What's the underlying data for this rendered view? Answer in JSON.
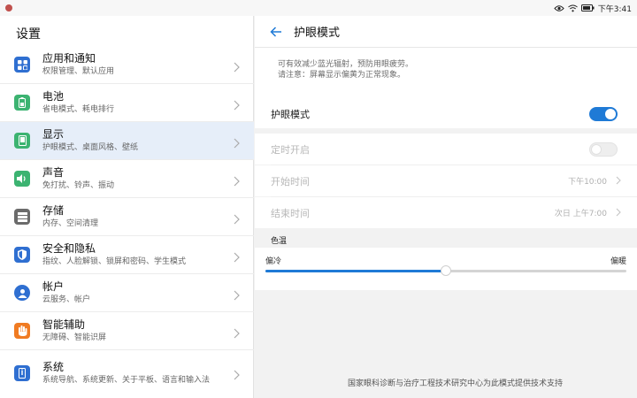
{
  "statusbar": {
    "time": "下午3:41"
  },
  "left": {
    "title": "设置",
    "items": [
      {
        "title": "应用和通知",
        "sub": "权限管理、默认应用",
        "icon": "apps-icon",
        "color": "#2f6fd1"
      },
      {
        "title": "电池",
        "sub": "省电模式、耗电排行",
        "icon": "battery-icon",
        "color": "#3cb371"
      },
      {
        "title": "显示",
        "sub": "护眼模式、桌面风格、壁纸",
        "icon": "display-icon",
        "color": "#3cb371"
      },
      {
        "title": "声音",
        "sub": "免打扰、铃声、振动",
        "icon": "sound-icon",
        "color": "#3cb371"
      },
      {
        "title": "存储",
        "sub": "内存、空间清理",
        "icon": "storage-icon",
        "color": "#6b6b6b"
      },
      {
        "title": "安全和隐私",
        "sub": "指纹、人脸解锁、锁屏和密码、学生模式",
        "icon": "shield-icon",
        "color": "#2f6fd1"
      },
      {
        "title": "帐户",
        "sub": "云服务、帐户",
        "icon": "account-icon",
        "color": "#2f6fd1"
      },
      {
        "title": "智能辅助",
        "sub": "无障碍、智能识屏",
        "icon": "hand-icon",
        "color": "#f07b22"
      },
      {
        "title": "系统",
        "sub": "系统导航、系统更新、关于平板、语言和输入法",
        "icon": "system-icon",
        "color": "#2f6fd1"
      }
    ]
  },
  "right": {
    "title": "护眼模式",
    "desc_line1": "可有效减少蓝光辐射，预防用眼疲劳。",
    "desc_line2": "请注意：屏幕显示偏黄为正常现象。",
    "main_toggle_label": "护眼模式",
    "main_toggle_on": true,
    "schedule_label": "定时开启",
    "schedule_on": false,
    "start_label": "开始时间",
    "start_value": "下午10:00",
    "end_label": "结束时间",
    "end_value": "次日 上午7:00",
    "temp_section": "色温",
    "temp_cold": "偏冷",
    "temp_warm": "偏暖",
    "temp_level": 0.5,
    "footer": "国家眼科诊断与治疗工程技术研究中心为此模式提供技术支持"
  },
  "colors": {
    "accent": "#1f7ad6",
    "active_bg": "#e6eef9"
  }
}
